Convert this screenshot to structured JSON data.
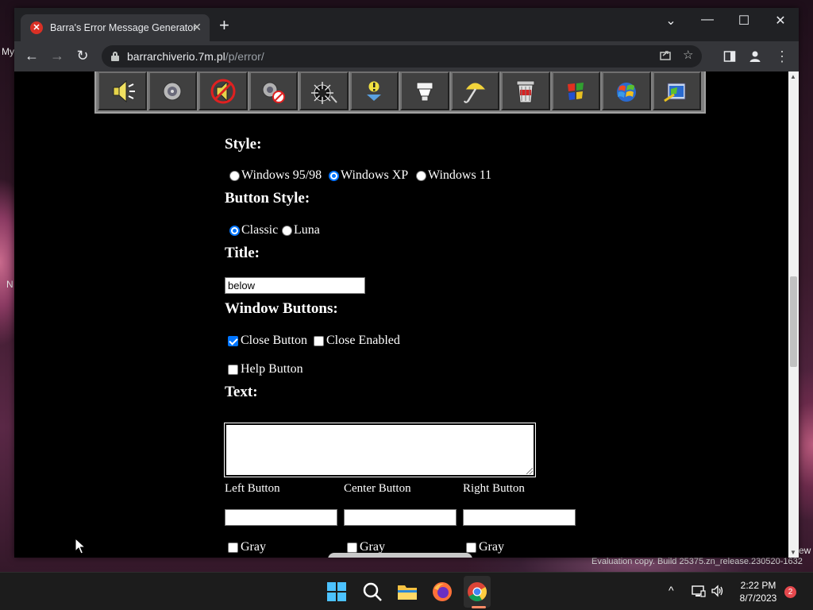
{
  "desktop": {
    "left_labels": [
      "My",
      "N"
    ],
    "right_label": "ew",
    "watermark": "Evaluation copy. Build 25375.zn_release.230520-1632"
  },
  "browser": {
    "tab": {
      "favicon": "error-x-icon",
      "title": "Barra's Error Message Generator",
      "close": "✕"
    },
    "new_tab": "+",
    "window_controls": {
      "tabsearch": "⌄",
      "minimize": "—",
      "maximize": "☐",
      "close": "✕"
    },
    "nav": {
      "back": "←",
      "forward": "→",
      "reload": "↻"
    },
    "url": {
      "host": "barrarchiverio.7m.pl",
      "path": "/p/error/"
    },
    "omnibox_icons": [
      "share-icon",
      "star-icon"
    ],
    "toolbar_icons": [
      "side-panel-icon",
      "profile-icon",
      "menu-icon"
    ]
  },
  "page": {
    "icons": [
      "speaker-icon",
      "sound-icon",
      "mute-icon",
      "no-sound-icon",
      "bomb-icon",
      "info-icon",
      "toilet-icon",
      "umbrella-icon",
      "trash-icon",
      "windows-flag-icon",
      "windows-logo-icon",
      "setup-icon"
    ],
    "style": {
      "heading": "Style:",
      "options": [
        "Windows 95/98",
        "Windows XP",
        "Windows 11"
      ],
      "selected": "Windows XP"
    },
    "button_style": {
      "heading": "Button Style:",
      "options": [
        "Classic",
        "Luna"
      ],
      "selected": "Classic"
    },
    "title": {
      "heading": "Title:",
      "value": "below"
    },
    "window_buttons": {
      "heading": "Window Buttons:",
      "close_button": {
        "label": "Close Button",
        "checked": true
      },
      "close_enabled": {
        "label": "Close Enabled",
        "checked": false
      },
      "help_button": {
        "label": "Help Button",
        "checked": false
      }
    },
    "text": {
      "heading": "Text:",
      "value": ""
    },
    "buttons": {
      "left": {
        "label": "Left Button",
        "value": "",
        "gray_label": "Gray"
      },
      "center": {
        "label": "Center Button",
        "value": "",
        "gray_label": "Gray"
      },
      "right": {
        "label": "Right Button",
        "value": "",
        "gray_label": "Gray"
      }
    }
  },
  "taskbar": {
    "apps": [
      "start-icon",
      "search-icon",
      "file-explorer-icon",
      "firefox-icon",
      "chrome-icon"
    ],
    "tray": {
      "chevron": "^",
      "icons": [
        "network-icon",
        "volume-icon"
      ]
    },
    "time": "2:22 PM",
    "date": "8/7/2023",
    "notification_count": "2"
  }
}
